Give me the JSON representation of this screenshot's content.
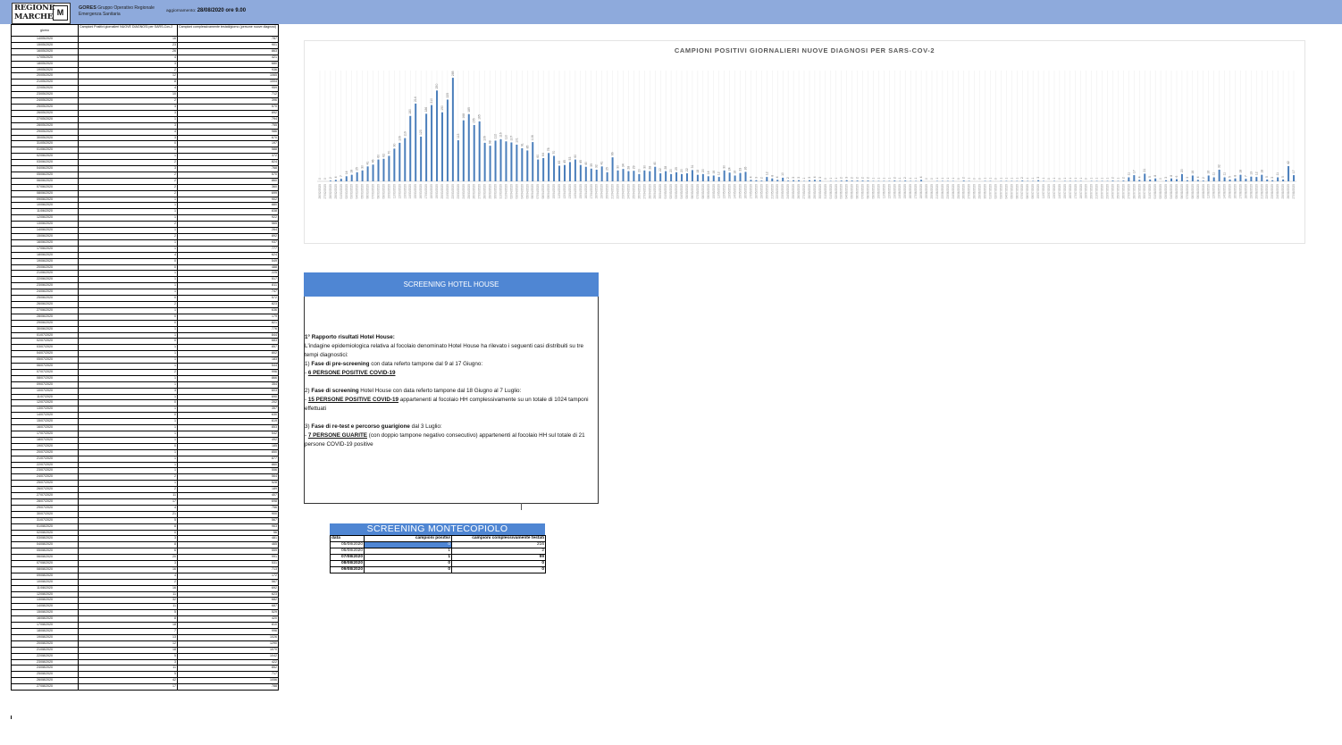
{
  "header": {
    "logo_text": "REGIONE MARCHE",
    "logo_mark": "M",
    "org_name": "GORES",
    "org_desc_1": "Gruppo Operativo Regionale",
    "org_desc_2": "Emergenza Sanitaria",
    "update_label": "aggiornamento:",
    "update_value": "28/08/2020 ore 9.00"
  },
  "colors": {
    "accent": "#4f86d3",
    "topbar": "#8eaadc",
    "bars": "#4a7ebb"
  },
  "daily_table": {
    "headers": [
      "giorno",
      "Campioni Positivi giornalieri NUOVE DIAGNOSI per SARS-Cov-2",
      "Campioni complessivamente testati/giorno (persone nuove diagnosi)"
    ],
    "rows": [
      [
        "14/05/2020",
        "16",
        "787"
      ],
      [
        "15/05/2020",
        "23",
        "901"
      ],
      [
        "16/05/2020",
        "26",
        "863"
      ],
      [
        "17/05/2020",
        "4",
        "421"
      ],
      [
        "18/05/2020",
        "3",
        "680"
      ],
      [
        "19/05/2020",
        "2",
        "936"
      ],
      [
        "20/05/2020",
        "12",
        "1065"
      ],
      [
        "21/05/2020",
        "8",
        "1004"
      ],
      [
        "22/05/2020",
        "4",
        "959"
      ],
      [
        "23/05/2020",
        "10",
        "712"
      ],
      [
        "24/05/2020",
        "2",
        "396"
      ],
      [
        "25/05/2020",
        "3",
        "570"
      ],
      [
        "26/05/2020",
        "3",
        "892"
      ],
      [
        "27/05/2020",
        "1",
        "794"
      ],
      [
        "28/05/2020",
        "3",
        "755"
      ],
      [
        "29/05/2020",
        "4",
        "986"
      ],
      [
        "30/05/2020",
        "3",
        "670"
      ],
      [
        "31/05/2020",
        "0",
        "197"
      ],
      [
        "01/06/2020",
        "1",
        "588"
      ],
      [
        "02/06/2020",
        "1",
        "372"
      ],
      [
        "03/06/2020",
        "2",
        "824"
      ],
      [
        "04/06/2020",
        "3",
        "768"
      ],
      [
        "05/06/2020",
        "2",
        "570"
      ],
      [
        "06/06/2020",
        "2",
        "860"
      ],
      [
        "07/06/2020",
        "2",
        "360"
      ],
      [
        "08/06/2020",
        "2",
        "699"
      ],
      [
        "09/06/2020",
        "1",
        "902"
      ],
      [
        "10/06/2020",
        "1",
        "880"
      ],
      [
        "11/06/2020",
        "1",
        "838"
      ],
      [
        "12/06/2020",
        "1",
        "922"
      ],
      [
        "13/06/2020",
        "2",
        "565"
      ],
      [
        "14/06/2020",
        "1",
        "264"
      ],
      [
        "15/06/2020",
        "2",
        "892"
      ],
      [
        "16/06/2020",
        "1",
        "937"
      ],
      [
        "17/06/2020",
        "1",
        "777"
      ],
      [
        "18/06/2020",
        "4",
        "624"
      ],
      [
        "19/06/2020",
        "0",
        "549"
      ],
      [
        "20/06/2020",
        "0",
        "488"
      ],
      [
        "21/06/2020",
        "1",
        "225"
      ],
      [
        "22/06/2020",
        "1",
        "517"
      ],
      [
        "23/06/2020",
        "1",
        "811"
      ],
      [
        "24/06/2020",
        "1",
        "747"
      ],
      [
        "25/06/2020",
        "0",
        "572"
      ],
      [
        "26/06/2020",
        "2",
        "823"
      ],
      [
        "27/06/2020",
        "1",
        "636"
      ],
      [
        "28/06/2020",
        "0",
        "179"
      ],
      [
        "29/06/2020",
        "0",
        "821"
      ],
      [
        "30/06/2020",
        "1",
        "776"
      ],
      [
        "01/07/2020",
        "1",
        "844"
      ],
      [
        "02/07/2020",
        "0",
        "683"
      ],
      [
        "03/07/2020",
        "1",
        "857"
      ],
      [
        "04/07/2020",
        "1",
        "802"
      ],
      [
        "05/07/2020",
        "1",
        "183"
      ],
      [
        "06/07/2020",
        "1",
        "544"
      ],
      [
        "07/07/2020",
        "2",
        "996"
      ],
      [
        "08/07/2020",
        "1",
        "866"
      ],
      [
        "09/07/2020",
        "1",
        "354"
      ],
      [
        "10/07/2020",
        "3",
        "603"
      ],
      [
        "11/07/2020",
        "1",
        "690"
      ],
      [
        "12/07/2020",
        "0",
        "202"
      ],
      [
        "13/07/2020",
        "1",
        "357"
      ],
      [
        "14/07/2020",
        "0",
        "630"
      ],
      [
        "15/07/2020",
        "1",
        "619"
      ],
      [
        "16/07/2020",
        "1",
        "853"
      ],
      [
        "17/07/2020",
        "1",
        "542"
      ],
      [
        "18/07/2020",
        "1",
        "492"
      ],
      [
        "19/07/2020",
        "0",
        "185"
      ],
      [
        "20/07/2020",
        "1",
        "850"
      ],
      [
        "21/07/2020",
        "1",
        "877"
      ],
      [
        "22/07/2020",
        "1",
        "860"
      ],
      [
        "23/07/2020",
        "1",
        "556"
      ],
      [
        "24/07/2020",
        "2",
        "564"
      ],
      [
        "25/07/2020",
        "1",
        "528"
      ],
      [
        "26/07/2020",
        "2",
        "189"
      ],
      [
        "27/07/2020",
        "11",
        "407"
      ],
      [
        "28/07/2020",
        "17",
        "698"
      ],
      [
        "29/07/2020",
        "4",
        "756"
      ],
      [
        "30/07/2020",
        "21",
        "900"
      ],
      [
        "31/07/2020",
        "5",
        "567"
      ],
      [
        "01/08/2020",
        "8",
        "963"
      ],
      [
        "02/08/2020",
        "0",
        "56"
      ],
      [
        "03/08/2020",
        "3",
        "481"
      ],
      [
        "04/08/2020",
        "8",
        "465"
      ],
      [
        "05/08/2020",
        "6",
        "559"
      ],
      [
        "06/08/2020",
        "20",
        "991"
      ],
      [
        "07/08/2020",
        "3",
        "531"
      ],
      [
        "08/08/2020",
        "16",
        "713"
      ],
      [
        "09/08/2020",
        "4",
        "172"
      ],
      [
        "10/08/2020",
        "2",
        "567"
      ],
      [
        "11/08/2020",
        "16",
        "692"
      ],
      [
        "12/08/2020",
        "11",
        "623"
      ],
      [
        "13/08/2020",
        "32",
        "682"
      ],
      [
        "14/08/2020",
        "11",
        "687"
      ],
      [
        "15/08/2020",
        "5",
        "529"
      ],
      [
        "16/08/2020",
        "8",
        "420"
      ],
      [
        "17/08/2020",
        "18",
        "810"
      ],
      [
        "18/08/2020",
        "7",
        "996"
      ],
      [
        "19/08/2020",
        "13",
        "1026"
      ],
      [
        "20/08/2020",
        "12",
        "1290"
      ],
      [
        "21/08/2020",
        "18",
        "1070"
      ],
      [
        "22/08/2020",
        "5",
        "1042"
      ],
      [
        "23/08/2020",
        "3",
        "422"
      ],
      [
        "24/08/2020",
        "11",
        "852"
      ],
      [
        "25/08/2020",
        "5",
        "717"
      ],
      [
        "26/08/2020",
        "42",
        "1056"
      ],
      [
        "27/08/2020",
        "17",
        "788"
      ]
    ]
  },
  "chart_data": {
    "type": "bar",
    "title": "CAMPIONI POSITIVI GIORNALIERI NUOVE DIAGNOSI PER SARS-COV-2",
    "xlabel": "",
    "ylabel": "",
    "legend": "none",
    "grid": true,
    "start_date": "2020-02-26",
    "categories": [
      "26/02/2020",
      "27/02/2020",
      "28/02/2020",
      "29/02/2020",
      "01/03/2020",
      "02/03/2020",
      "03/03/2020",
      "04/03/2020",
      "05/03/2020",
      "06/03/2020",
      "07/03/2020",
      "08/03/2020",
      "09/03/2020",
      "10/03/2020",
      "11/03/2020",
      "12/03/2020",
      "13/03/2020",
      "14/03/2020",
      "15/03/2020",
      "16/03/2020",
      "17/03/2020",
      "18/03/2020",
      "19/03/2020",
      "20/03/2020",
      "21/03/2020",
      "22/03/2020",
      "23/03/2020",
      "24/03/2020",
      "25/03/2020",
      "26/03/2020",
      "27/03/2020",
      "28/03/2020",
      "29/03/2020",
      "30/03/2020",
      "31/03/2020",
      "01/04/2020",
      "02/04/2020",
      "03/04/2020",
      "04/04/2020",
      "05/04/2020",
      "06/04/2020",
      "07/04/2020",
      "08/04/2020",
      "09/04/2020",
      "10/04/2020",
      "11/04/2020",
      "12/04/2020",
      "13/04/2020",
      "14/04/2020",
      "15/04/2020",
      "16/04/2020",
      "17/04/2020",
      "18/04/2020",
      "19/04/2020",
      "20/04/2020",
      "21/04/2020",
      "22/04/2020",
      "23/04/2020",
      "24/04/2020",
      "25/04/2020",
      "26/04/2020",
      "27/04/2020",
      "28/04/2020",
      "29/04/2020",
      "30/04/2020",
      "01/05/2020",
      "02/05/2020",
      "03/05/2020",
      "04/05/2020",
      "05/05/2020",
      "06/05/2020",
      "07/05/2020",
      "08/05/2020",
      "09/05/2020",
      "10/05/2020",
      "11/05/2020",
      "12/05/2020",
      "13/05/2020",
      "14/05/2020",
      "15/05/2020",
      "16/05/2020",
      "17/05/2020",
      "18/05/2020",
      "19/05/2020",
      "20/05/2020",
      "21/05/2020",
      "22/05/2020",
      "23/05/2020",
      "24/05/2020",
      "25/05/2020",
      "26/05/2020",
      "27/05/2020",
      "28/05/2020",
      "29/05/2020",
      "30/05/2020",
      "31/05/2020",
      "01/06/2020",
      "02/06/2020",
      "03/06/2020",
      "04/06/2020",
      "05/06/2020",
      "06/06/2020",
      "07/06/2020",
      "08/06/2020",
      "09/06/2020",
      "10/06/2020",
      "11/06/2020",
      "12/06/2020",
      "13/06/2020",
      "14/06/2020",
      "15/06/2020",
      "16/06/2020",
      "17/06/2020",
      "18/06/2020",
      "19/06/2020",
      "20/06/2020",
      "21/06/2020",
      "22/06/2020",
      "23/06/2020",
      "24/06/2020",
      "25/06/2020",
      "26/06/2020",
      "27/06/2020",
      "28/06/2020",
      "29/06/2020",
      "30/06/2020",
      "01/07/2020",
      "02/07/2020",
      "03/07/2020",
      "04/07/2020",
      "05/07/2020",
      "06/07/2020",
      "07/07/2020",
      "08/07/2020",
      "09/07/2020",
      "10/07/2020",
      "11/07/2020",
      "12/07/2020",
      "13/07/2020",
      "14/07/2020",
      "15/07/2020",
      "16/07/2020",
      "17/07/2020",
      "18/07/2020",
      "19/07/2020",
      "20/07/2020",
      "21/07/2020",
      "22/07/2020",
      "23/07/2020",
      "24/07/2020",
      "25/07/2020",
      "26/07/2020",
      "27/07/2020",
      "28/07/2020",
      "29/07/2020",
      "30/07/2020",
      "31/07/2020",
      "01/08/2020",
      "02/08/2020",
      "03/08/2020",
      "04/08/2020",
      "05/08/2020",
      "06/08/2020",
      "07/08/2020",
      "08/08/2020",
      "09/08/2020",
      "10/08/2020",
      "11/08/2020",
      "12/08/2020",
      "13/08/2020",
      "14/08/2020",
      "15/08/2020",
      "16/08/2020",
      "17/08/2020",
      "18/08/2020",
      "19/08/2020",
      "20/08/2020",
      "21/08/2020",
      "22/08/2020",
      "23/08/2020",
      "24/08/2020",
      "25/08/2020",
      "26/08/2020",
      "27/08/2020"
    ],
    "values": [
      0,
      0,
      2,
      4,
      7,
      14,
      18,
      25,
      30,
      41,
      46,
      60,
      62,
      70,
      90,
      106,
      119,
      180,
      214,
      123,
      186,
      210,
      250,
      190,
      225,
      285,
      113,
      168,
      185,
      155,
      165,
      106,
      98,
      112,
      116,
      110,
      107,
      101,
      91,
      85,
      108,
      60,
      64,
      78,
      70,
      43,
      45,
      53,
      60,
      45,
      40,
      35,
      32,
      41,
      25,
      66,
      30,
      34,
      28,
      29,
      20,
      30,
      28,
      40,
      22,
      28,
      20,
      25,
      20,
      22,
      31,
      18,
      20,
      14,
      16,
      12,
      30,
      24,
      16,
      23,
      26,
      4,
      3,
      2,
      12,
      8,
      4,
      10,
      2,
      3,
      3,
      1,
      3,
      4,
      3,
      0,
      1,
      1,
      2,
      3,
      2,
      2,
      2,
      2,
      1,
      1,
      1,
      1,
      2,
      1,
      2,
      1,
      1,
      4,
      0,
      0,
      1,
      1,
      1,
      1,
      0,
      2,
      1,
      0,
      0,
      1,
      1,
      0,
      1,
      1,
      1,
      1,
      2,
      1,
      1,
      3,
      1,
      0,
      1,
      0,
      1,
      1,
      1,
      1,
      0,
      1,
      1,
      1,
      1,
      2,
      1,
      2,
      11,
      17,
      4,
      21,
      5,
      8,
      0,
      3,
      8,
      6,
      20,
      3,
      16,
      4,
      2,
      16,
      11,
      32,
      11,
      5,
      8,
      18,
      7,
      13,
      12,
      18,
      5,
      3,
      11,
      5,
      42,
      17
    ],
    "ylim": [
      0,
      300
    ]
  },
  "hotel_house": {
    "title": "SCREENING HOTEL HOUSE",
    "report_title": "1° Rapporto  risultati Hotel House",
    "intro": "L'indagine epidemiologica relativa al focolaio denominato Hotel House ha rilevato i seguenti casi distribuiti su tre tempi diagnostici:",
    "phase1_prefix": "1) ",
    "phase1_label": "Fase di pre-screening",
    "phase1_text": " con data referto tampone dal 9 al 17 Giugno:",
    "phase1_result": "6 PERSONE POSITIVE COVID-19",
    "phase2_prefix": "2) ",
    "phase2_label": "Fase di screening",
    "phase2_text": " Hotel House con data referto tampone dal 18 Giugno al 7 Luglio:",
    "phase2_result": "15 PERSONE POSITIVE COVID-19",
    "phase2_tail": " appartenenti al focolaio HH complessivamente su un totale di 1024 tamponi effettuati",
    "phase3_prefix": "3) ",
    "phase3_label": "Fase di re-test e percorso guarigione",
    "phase3_text": " dal 3 Luglio:",
    "phase3_result": "7 PERSONE GUARITE",
    "phase3_tail": " (con doppio tampone negativo consecutivo) appartenenti al focolaio HH sul totale di 21 persone COVID-19 positive",
    "dash": "- "
  },
  "montecopiolo": {
    "title": "SCREENING MONTECOPIOLO",
    "headers": [
      "data",
      "campioni positivi",
      "campioni complessivamente testati"
    ],
    "rows": [
      [
        "05/08/2020",
        "0",
        "216"
      ],
      [
        "06/08/2020",
        "1",
        "2"
      ],
      [
        "07/08/2020",
        "1",
        "99"
      ],
      [
        "08/08/2020",
        "0",
        "0"
      ],
      [
        "09/08/2020",
        "0",
        "0"
      ]
    ]
  }
}
